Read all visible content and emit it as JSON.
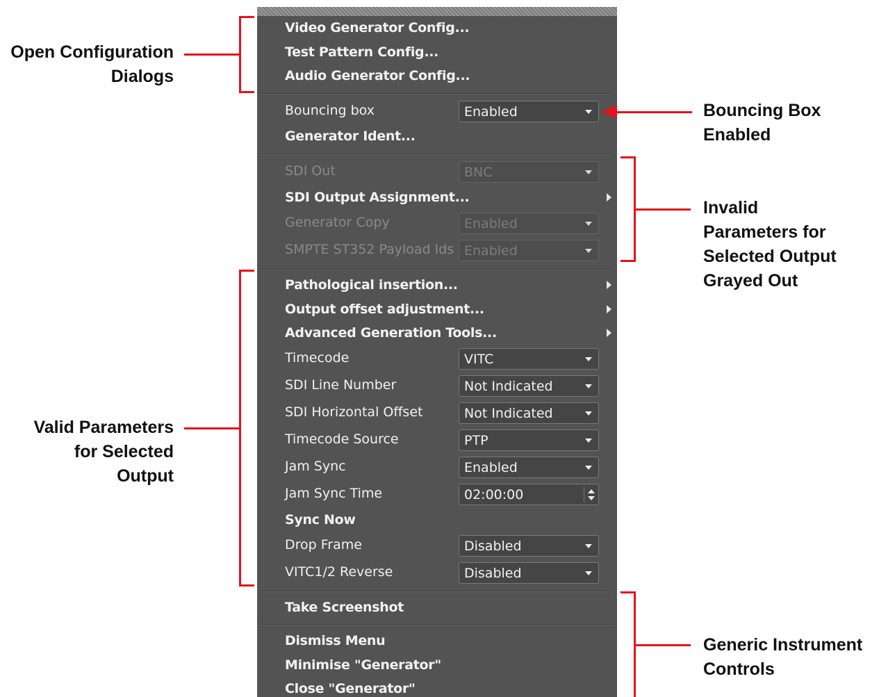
{
  "menu": {
    "items": {
      "video_generator_config": "Video Generator Config...",
      "test_pattern_config": "Test Pattern Config...",
      "audio_generator_config": "Audio Generator Config...",
      "bouncing_box_label": "Bouncing box",
      "bouncing_box_value": "Enabled",
      "generator_ident": "Generator Ident...",
      "sdi_out_label": "SDI Out",
      "sdi_out_value": "BNC",
      "sdi_output_assignment": "SDI Output Assignment...",
      "generator_copy_label": "Generator Copy",
      "generator_copy_value": "Enabled",
      "smpte_payload_label": "SMPTE ST352 Payload Ids",
      "smpte_payload_value": "Enabled",
      "pathological_insertion": "Pathological insertion...",
      "output_offset_adjustment": "Output offset adjustment...",
      "advanced_generation_tools": "Advanced Generation Tools...",
      "timecode_label": "Timecode",
      "timecode_value": "VITC",
      "sdi_line_number_label": "SDI Line Number",
      "sdi_line_number_value": "Not Indicated",
      "sdi_horizontal_offset_label": "SDI Horizontal Offset",
      "sdi_horizontal_offset_value": "Not Indicated",
      "timecode_source_label": "Timecode Source",
      "timecode_source_value": "PTP",
      "jam_sync_label": "Jam Sync",
      "jam_sync_value": "Enabled",
      "jam_sync_time_label": "Jam Sync Time",
      "jam_sync_time_value": "02:00:00",
      "sync_now": "Sync Now",
      "drop_frame_label": "Drop Frame",
      "drop_frame_value": "Disabled",
      "vitc_reverse_label": "VITC1/2 Reverse",
      "vitc_reverse_value": "Disabled",
      "take_screenshot": "Take Screenshot",
      "dismiss_menu": "Dismiss Menu",
      "minimise_generator": "Minimise \"Generator\"",
      "close_generator": "Close \"Generator\""
    }
  },
  "annotations": {
    "open_config": [
      "Open Configuration",
      "Dialogs"
    ],
    "bouncing_box": [
      "Bouncing Box",
      "Enabled"
    ],
    "invalid_params": [
      "Invalid",
      "Parameters for",
      "Selected Output",
      "Grayed Out"
    ],
    "valid_params": [
      "Valid Parameters",
      "for Selected",
      "Output"
    ],
    "generic_controls": [
      "Generic Instrument",
      "Controls"
    ]
  },
  "colors": {
    "menu_bg": "#535353",
    "annotation_red": "#e3121b"
  }
}
